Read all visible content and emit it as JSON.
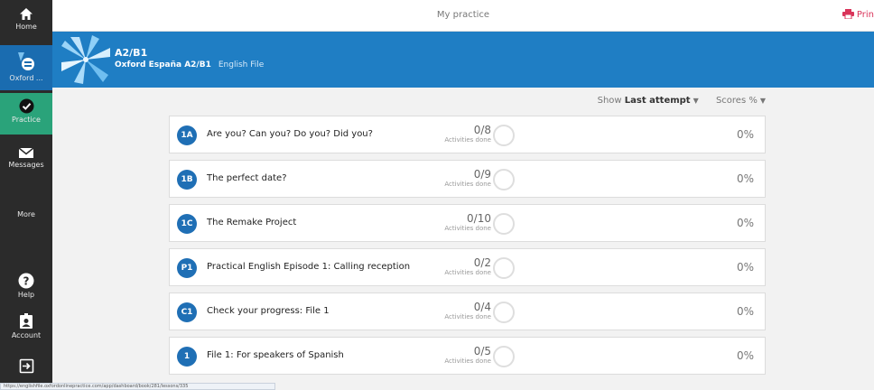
{
  "sidebar": {
    "items": [
      {
        "label": "Home",
        "icon": "home-icon"
      },
      {
        "label": "Oxford ...",
        "icon": "oxford-app-icon"
      },
      {
        "label": "Practice",
        "icon": "check-circle-icon"
      },
      {
        "label": "Messages",
        "icon": "envelope-icon"
      },
      {
        "label": "More",
        "icon": ""
      },
      {
        "label": "Help",
        "icon": "help-icon"
      },
      {
        "label": "Account",
        "icon": "account-icon"
      },
      {
        "label": "",
        "icon": "logout-icon"
      }
    ],
    "active_color": "#2aa37a"
  },
  "header": {
    "title": "My practice",
    "print_label": "Prin"
  },
  "course": {
    "level": "A2/B1",
    "publisher": "Oxford España A2/B1",
    "product": "English File",
    "banner_color": "#1f7ec4"
  },
  "filters": {
    "show_label": "Show",
    "show_value": "Last attempt",
    "scores_label": "Scores %"
  },
  "units": [
    {
      "badge": "1A",
      "title": "Are you? Can you? Do you? Did you?",
      "done": "0/8",
      "done_label": "Activities done",
      "score": "0%"
    },
    {
      "badge": "1B",
      "title": "The perfect date?",
      "done": "0/9",
      "done_label": "Activities done",
      "score": "0%"
    },
    {
      "badge": "1C",
      "title": "The Remake Project",
      "done": "0/10",
      "done_label": "Activities done",
      "score": "0%"
    },
    {
      "badge": "P1",
      "title": "Practical English Episode 1: Calling reception",
      "done": "0/2",
      "done_label": "Activities done",
      "score": "0%"
    },
    {
      "badge": "C1",
      "title": "Check your progress: File 1",
      "done": "0/4",
      "done_label": "Activities done",
      "score": "0%"
    },
    {
      "badge": "1",
      "title": "File 1: For speakers of Spanish",
      "done": "0/5",
      "done_label": "Activities done",
      "score": "0%"
    }
  ],
  "status_bar": {
    "url": "https://englishfile.oxfordonlinepractice.com/app/dashboard/book/281/lessons/335"
  }
}
